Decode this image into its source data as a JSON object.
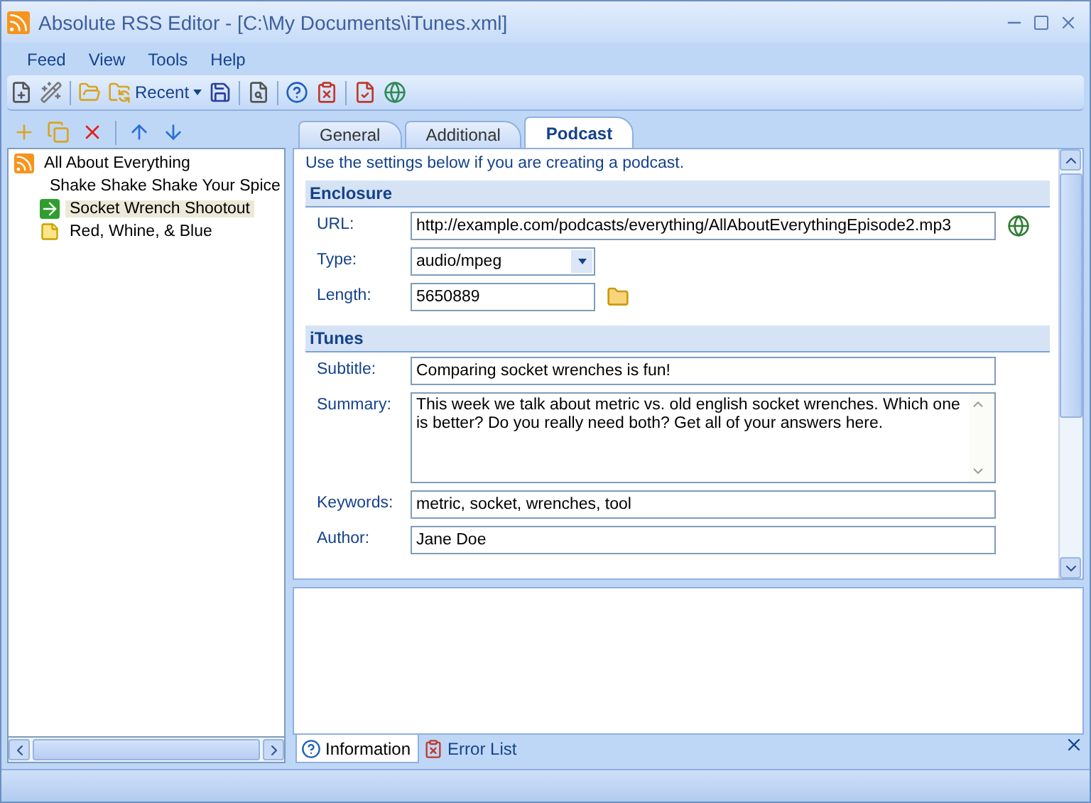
{
  "window": {
    "title": "Absolute RSS Editor - [C:\\My Documents\\iTunes.xml]"
  },
  "menu": [
    {
      "label": "Feed"
    },
    {
      "label": "View"
    },
    {
      "label": "Tools"
    },
    {
      "label": "Help"
    }
  ],
  "toolbar": {
    "recent_label": "Recent"
  },
  "tree": {
    "label": "All About Everything",
    "children": [
      {
        "label": "Shake Shake Shake Your Spice",
        "selected": false
      },
      {
        "label": "Socket Wrench Shootout",
        "selected": true
      },
      {
        "label": "Red, Whine, & Blue",
        "selected": false
      }
    ]
  },
  "tabs": [
    {
      "label": "General",
      "selected": false
    },
    {
      "label": "Additional",
      "selected": false
    },
    {
      "label": "Podcast",
      "selected": true
    }
  ],
  "intro": "Use the settings below if you are creating a podcast.",
  "sections": [
    {
      "title": "Enclosure",
      "fields": [
        {
          "label": "URL:",
          "kind": "url",
          "value": "http://example.com/podcasts/everything/AllAboutEverythingEpisode2.mp3"
        },
        {
          "label": "Type:",
          "kind": "select",
          "value": "audio/mpeg"
        },
        {
          "label": "Length:",
          "kind": "file",
          "value": "5650889"
        }
      ]
    },
    {
      "title": "iTunes",
      "fields": [
        {
          "label": "Subtitle:",
          "kind": "text",
          "value": "Comparing socket wrenches is fun!"
        },
        {
          "label": "Summary:",
          "kind": "textarea",
          "value": "This week we talk about metric vs. old english socket wrenches. Which one is better? Do you really need both? Get all of your answers here."
        },
        {
          "label": "Keywords:",
          "kind": "text",
          "value": "metric, socket, wrenches, tool"
        },
        {
          "label": "Author:",
          "kind": "text",
          "value": "Jane Doe"
        }
      ]
    }
  ],
  "bottom_tabs": [
    {
      "label": "Information",
      "selected": true
    },
    {
      "label": "Error List",
      "selected": false
    }
  ]
}
